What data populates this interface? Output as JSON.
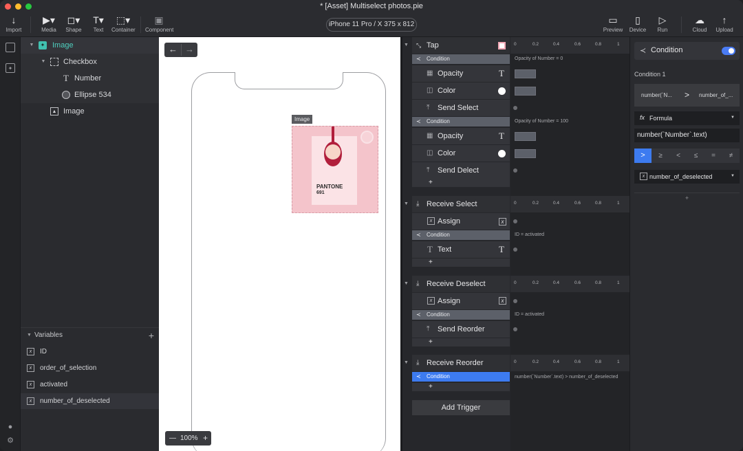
{
  "window": {
    "title": "* [Asset] Multiselect photos.pie"
  },
  "toolbar": {
    "import": "Import",
    "media": "Media",
    "shape": "Shape",
    "text": "Text",
    "container": "Container",
    "component": "Component",
    "device": "iPhone 11 Pro / X  375 x 812",
    "preview": "Preview",
    "device_btn": "Device",
    "run": "Run",
    "cloud": "Cloud",
    "upload": "Upload"
  },
  "layers": [
    {
      "label": "Image",
      "kind": "image-group",
      "selected": true
    },
    {
      "label": "Checkbox",
      "kind": "container"
    },
    {
      "label": "Number",
      "kind": "text"
    },
    {
      "label": "Ellipse 534",
      "kind": "ellipse"
    },
    {
      "label": "Image",
      "kind": "image"
    }
  ],
  "variables": {
    "header": "Variables",
    "items": [
      "ID",
      "order_of_selection",
      "activated",
      "number_of_deselected"
    ]
  },
  "canvas": {
    "image_label": "Image",
    "photo_brand": "PANTONE",
    "photo_code": "691",
    "zoom": "100%"
  },
  "triggers": {
    "tap": "Tap",
    "condition": "Condition",
    "opacity": "Opacity",
    "color": "Color",
    "send_select": "Send Select",
    "send_delect": "Send Delect",
    "receive_select": "Receive Select",
    "assign": "Assign",
    "text": "Text",
    "receive_deselect": "Receive Deselect",
    "send_reorder": "Send Reorder",
    "receive_reorder": "Receive Reorder",
    "add_trigger": "Add Trigger",
    "plus": "+"
  },
  "timeline": {
    "ticks": [
      "0",
      "0.2",
      "0.4",
      "0.6",
      "0.8",
      "1"
    ],
    "cond1": "Opacity of Number = 0",
    "cond2": "Opacity of Number = 100",
    "cond3": "ID = activated",
    "cond4": "ID = activated",
    "cond5": "number(`Number`.text) > number_of_deselected"
  },
  "inspector": {
    "header": "Condition",
    "label": "Condition 1",
    "left": "number(`N...",
    "op": ">",
    "right": "number_of_...",
    "formula": "Formula",
    "formula_value": "number(`Number`.text)",
    "ops": [
      ">",
      "≥",
      "<",
      "≤",
      "=",
      "≠"
    ],
    "variable": "number_of_deselected",
    "add": "+"
  },
  "colors": {
    "accent": "#3d7bf0",
    "toggle": "#4a7cf5"
  }
}
